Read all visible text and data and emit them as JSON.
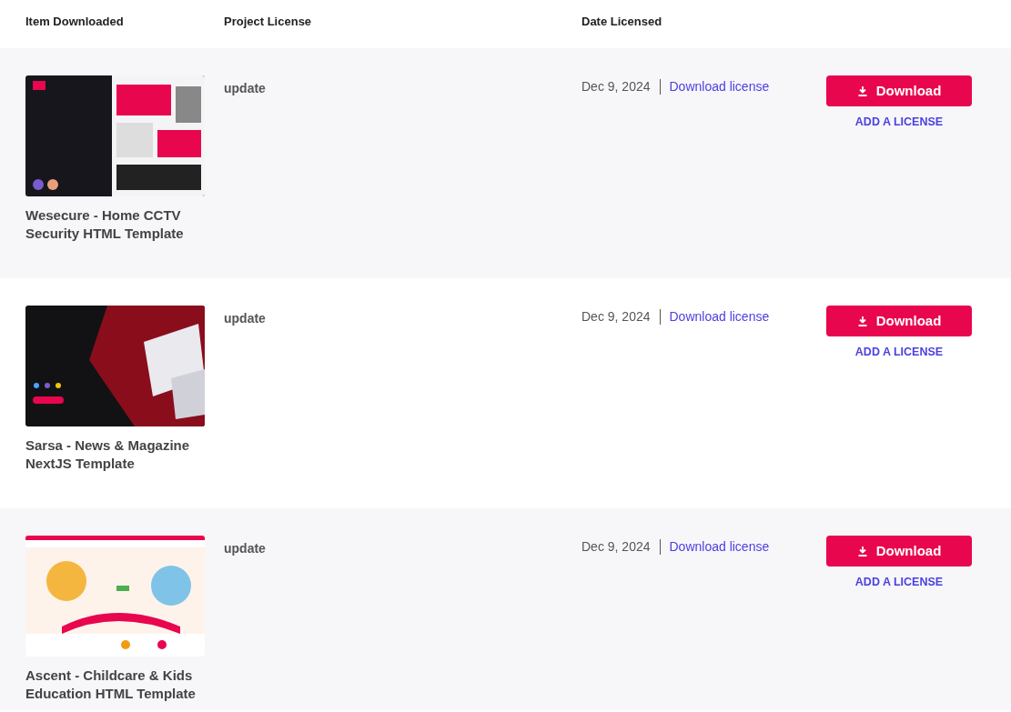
{
  "table": {
    "columns": [
      "Item Downloaded",
      "Project License",
      "Date Licensed"
    ],
    "rows": [
      {
        "title": "Wesecure - Home CCTV Security HTML Template",
        "license": "update",
        "date": "Dec 9, 2024",
        "license_link": "Download license",
        "download_button": "Download",
        "add_license": "ADD A LICENSE"
      },
      {
        "title": "Sarsa - News & Magazine NextJS Template",
        "license": "update",
        "date": "Dec 9, 2024",
        "license_link": "Download license",
        "download_button": "Download",
        "add_license": "ADD A LICENSE"
      },
      {
        "title": "Ascent - Childcare & Kids Education HTML Template",
        "license": "update",
        "date": "Dec 9, 2024",
        "license_link": "Download license",
        "download_button": "Download",
        "add_license": "ADD A LICENSE"
      }
    ]
  }
}
